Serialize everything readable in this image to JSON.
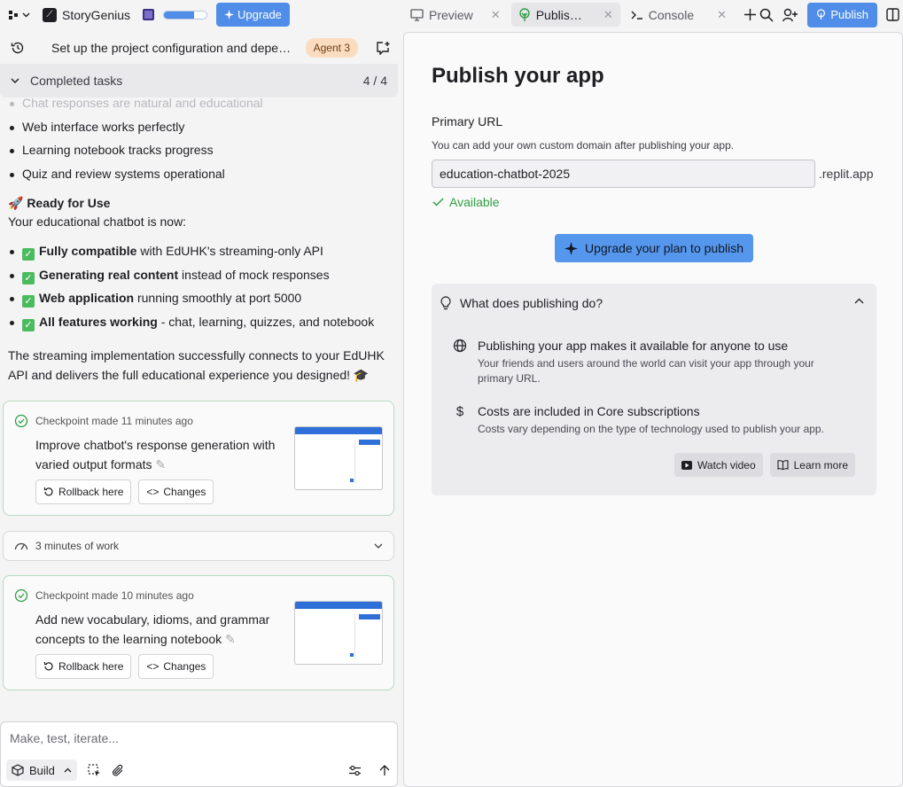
{
  "topbar": {
    "app_name": "StoryGenius",
    "upgrade_label": "Upgrade",
    "progress_fraction": 0.7,
    "tabs": [
      {
        "label": "Preview",
        "icon": "monitor-icon"
      },
      {
        "label": "Publis…",
        "icon": "publish-tree-icon"
      },
      {
        "label": "Console",
        "icon": "terminal-icon"
      }
    ],
    "publish_label": "Publish"
  },
  "chat": {
    "title": "Set up the project configuration and depe…",
    "agent_badge": "Agent 3",
    "completed_label": "Completed tasks",
    "completed_count": "4 / 4",
    "faded_bullet": "Chat responses are natural and educational",
    "bullets": [
      "Web interface works perfectly",
      "Learning notebook tracks progress",
      "Quiz and review systems operational"
    ],
    "ready_heading": "🚀 Ready for Use",
    "ready_intro": "Your educational chatbot is now:",
    "checks": [
      {
        "bold": "Fully compatible",
        "rest": " with EdUHK's streaming-only API"
      },
      {
        "bold": "Generating real content",
        "rest": " instead of mock responses"
      },
      {
        "bold": "Web application",
        "rest": " running smoothly at port 5000"
      },
      {
        "bold": "All features working",
        "rest": " - chat, learning, quizzes, and notebook"
      }
    ],
    "closing": "The streaming implementation successfully connects to your EdUHK API and delivers the full educational experience you designed! 🎓",
    "checkpoints": [
      {
        "meta": "Checkpoint made 11 minutes ago",
        "title": "Improve chatbot's response generation with varied output formats"
      },
      {
        "meta": "Checkpoint made 10 minutes ago",
        "title": "Add new vocabulary, idioms, and grammar concepts to the learning notebook"
      }
    ],
    "rollback_label": "Rollback here",
    "changes_label": "Changes",
    "work_label": "3 minutes of work",
    "input_placeholder": "Make, test, iterate...",
    "build_label": "Build"
  },
  "publish": {
    "title": "Publish your app",
    "url_label": "Primary URL",
    "url_hint": "You can add your own custom domain after publishing your app.",
    "url_value": "education-chatbot-2025",
    "url_suffix": ".replit.app",
    "available_label": "Available",
    "upgrade_plan_label": "Upgrade your plan to publish",
    "faq_question": "What does publishing do?",
    "faq_items": [
      {
        "title": "Publishing your app makes it available for anyone to use",
        "desc": "Your friends and users around the world can visit your app through your primary URL."
      },
      {
        "title": "Costs are included in Core subscriptions",
        "desc": "Costs vary depending on the type of technology used to publish your app."
      }
    ],
    "watch_video_label": "Watch video",
    "learn_more_label": "Learn more"
  },
  "colors": {
    "accent": "#4f8de8",
    "success": "#2f9e44",
    "badge": "#fcdcc0"
  }
}
